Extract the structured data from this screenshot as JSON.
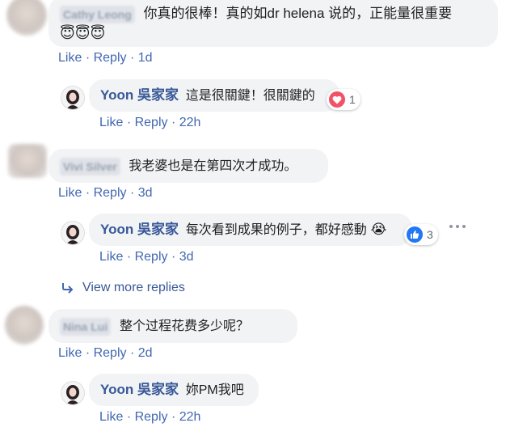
{
  "comments": [
    {
      "author": "Cathy Leong",
      "text": "你真的很棒！真的如dr helena 说的，正能量很重要",
      "emoji": "😇😇😇",
      "actions": {
        "like": "Like",
        "reply": "Reply",
        "time": "1d"
      },
      "reply": {
        "author": "Yoon 吳家家",
        "text": "這是很關鍵！很關鍵的",
        "reaction": {
          "icon": "love-heart",
          "count": "1",
          "color": "#f25268"
        },
        "actions": {
          "like": "Like",
          "reply": "Reply",
          "time": "22h"
        }
      }
    },
    {
      "author": "Vivi Silver",
      "text": "我老婆也是在第四次才成功。",
      "actions": {
        "like": "Like",
        "reply": "Reply",
        "time": "3d"
      },
      "reply": {
        "author": "Yoon 吳家家",
        "text": "每次看到成果的例子，都好感動",
        "emoji": "😭",
        "reaction": {
          "icon": "like-thumb",
          "count": "3",
          "color": "#2078f4"
        },
        "actions": {
          "like": "Like",
          "reply": "Reply",
          "time": "3d"
        }
      },
      "view_more": "View more replies"
    },
    {
      "author": "Nina Lui",
      "text": "整个过程花费多少呢？",
      "actions": {
        "like": "Like",
        "reply": "Reply",
        "time": "2d"
      },
      "reply": {
        "author": "Yoon 吳家家",
        "text": "妳PM我吧",
        "actions": {
          "like": "Like",
          "reply": "Reply",
          "time": "22h"
        }
      }
    }
  ],
  "more_options_icon": "ellipsis-icon"
}
